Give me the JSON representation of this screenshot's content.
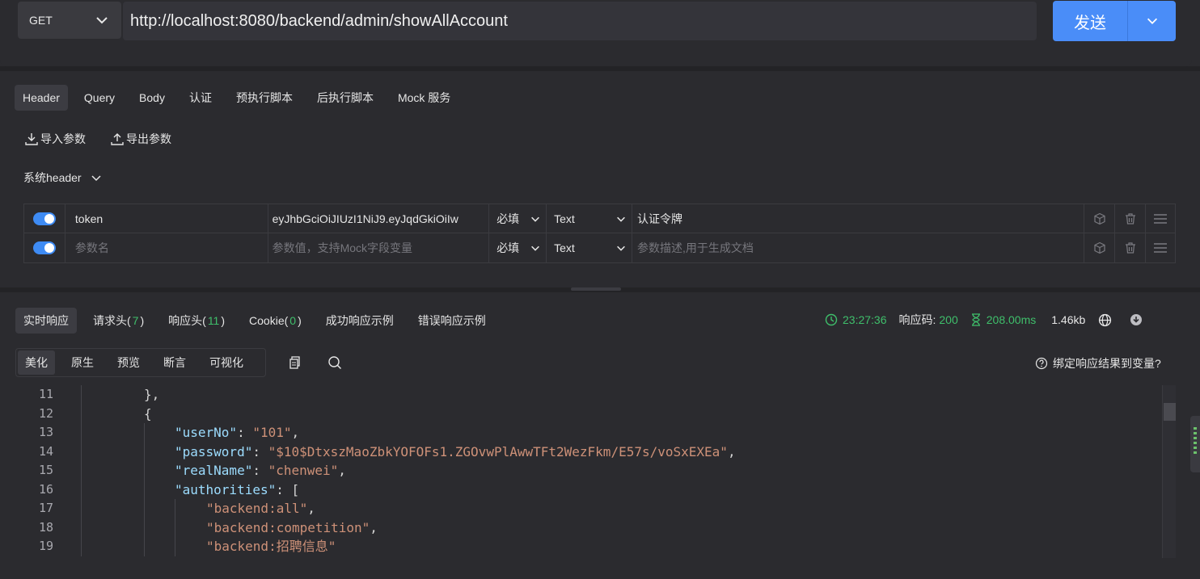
{
  "request": {
    "method": "GET",
    "url": "http://localhost:8080/backend/admin/showAllAccount",
    "send_label": "发送"
  },
  "tabs": [
    "Header",
    "Query",
    "Body",
    "认证",
    "预执行脚本",
    "后执行脚本",
    "Mock 服务"
  ],
  "actions": {
    "import": "导入参数",
    "export": "导出参数"
  },
  "sys_header_label": "系统header",
  "params": [
    {
      "enabled": true,
      "name": "token",
      "value": "eyJhbGciOiJIUzI1NiJ9.eyJqdGkiOiIw",
      "required": "必填",
      "type": "Text",
      "desc": "认证令牌"
    }
  ],
  "empty_row": {
    "name_placeholder": "参数名",
    "value_placeholder": "参数值，支持Mock字段变量",
    "required": "必填",
    "type": "Text",
    "desc_placeholder": "参数描述,用于生成文档"
  },
  "response": {
    "tabs": [
      {
        "label": "实时响应"
      },
      {
        "label": "请求头(",
        "count": "7",
        "suffix": ")"
      },
      {
        "label": "响应头(",
        "count": "11",
        "suffix": ")"
      },
      {
        "label": "Cookie(",
        "count": "0",
        "suffix": ")"
      },
      {
        "label": "成功响应示例"
      },
      {
        "label": "错误响应示例"
      }
    ],
    "time": "23:27:36",
    "code_label": "响应码:",
    "code": "200",
    "duration": "208.00ms",
    "size": "1.46kb",
    "view_modes": [
      "美化",
      "原生",
      "预览",
      "断言",
      "可视化"
    ],
    "bind_help": "绑定响应结果到变量?"
  },
  "code_lines": [
    {
      "n": "11",
      "text": "},"
    },
    {
      "n": "12",
      "text": "{"
    },
    {
      "n": "13",
      "key": "\"userNo\"",
      "val": "\"101\"",
      "end": ","
    },
    {
      "n": "14",
      "key": "\"password\"",
      "val": "\"$10$DtxszMaoZbkYOFOFs1.ZGOvwPlAwwTFt2WezFkm/E57s/voSxEXEa\"",
      "end": ","
    },
    {
      "n": "15",
      "key": "\"realName\"",
      "val": "\"chenwei\"",
      "end": ","
    },
    {
      "n": "16",
      "key": "\"authorities\"",
      "val": "",
      "end": "["
    },
    {
      "n": "17",
      "val": "\"backend:all\"",
      "end": ","
    },
    {
      "n": "18",
      "val": "\"backend:competition\"",
      "end": ","
    },
    {
      "n": "19",
      "val": "\"backend:招聘信息\"",
      "end": ""
    }
  ],
  "colors": {
    "accent": "#4a8df8",
    "success": "#3fbf6b"
  }
}
